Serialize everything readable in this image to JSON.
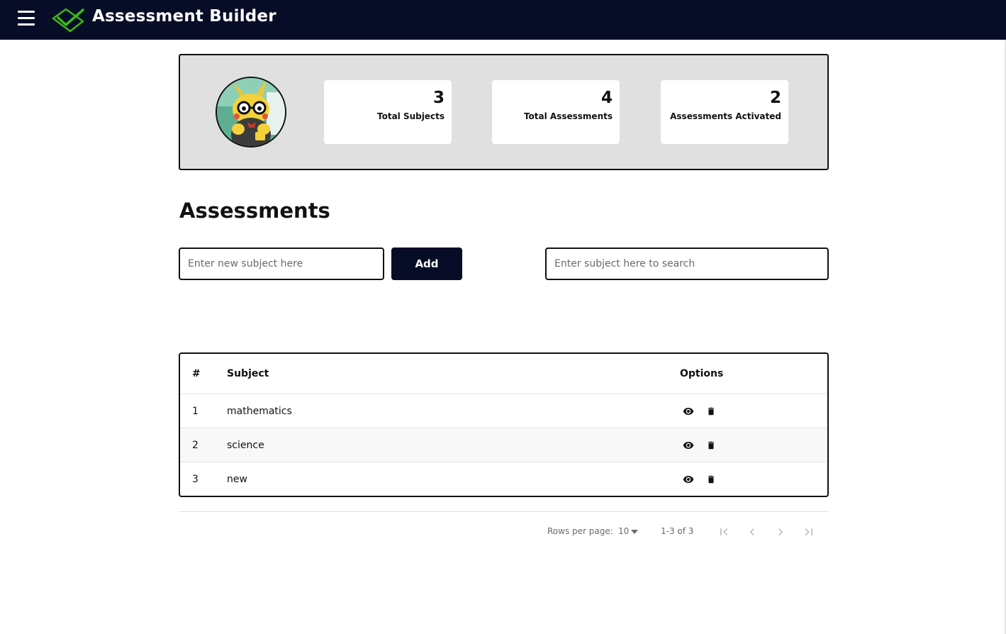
{
  "topbar": {
    "menu_icon": "hamburger-menu-icon",
    "logo_icon": "check-diamond-logo",
    "title": "Assessment Builder",
    "background": "#080d27",
    "logo_color": "#3fb618"
  },
  "stats": {
    "avatar": "profile-avatar",
    "cards": [
      {
        "value": "3",
        "label": "Total Subjects"
      },
      {
        "value": "4",
        "label": "Total Assessments"
      },
      {
        "value": "2",
        "label": "Assessments Activated"
      }
    ]
  },
  "section": {
    "title": "Assessments"
  },
  "add_form": {
    "placeholder": "Enter new subject here",
    "button_label": "Add"
  },
  "search": {
    "placeholder": "Enter subject here to search"
  },
  "table": {
    "headers": {
      "num": "#",
      "subject": "Subject",
      "options": "Options"
    },
    "rows": [
      {
        "num": "1",
        "subject": "mathematics"
      },
      {
        "num": "2",
        "subject": "science"
      },
      {
        "num": "3",
        "subject": "new"
      }
    ],
    "row_icons": [
      "eye-icon",
      "trash-icon"
    ]
  },
  "pagination": {
    "rows_per_page_label": "Rows per page:",
    "rows_per_page_value": "10",
    "range": "1-3 of 3",
    "buttons": [
      "first-page-icon",
      "prev-page-icon",
      "next-page-icon",
      "last-page-icon"
    ]
  }
}
